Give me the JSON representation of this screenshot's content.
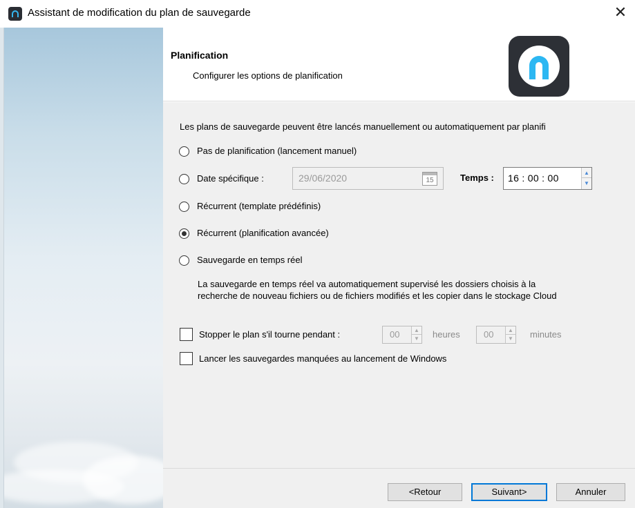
{
  "window": {
    "title": "Assistant de modification du plan de sauvegarde",
    "close_glyph": "✕"
  },
  "header": {
    "title": "Planification",
    "subtitle": "Configurer les options de planification",
    "logo_icon": "app-logo-icon"
  },
  "intro_text": "Les plans de sauvegarde peuvent être lancés manuellement ou automatiquement par planifi",
  "options": {
    "none": {
      "label": "Pas de planification (lancement manuel)",
      "selected": false
    },
    "specific_date": {
      "label": "Date spécifique :",
      "selected": false
    },
    "recurrent_template": {
      "label": "Récurrent (template prédéfinis)",
      "selected": false
    },
    "recurrent_advanced": {
      "label": "Récurrent (planification avancée)",
      "selected": true
    },
    "realtime": {
      "label": "Sauvegarde en temps réel",
      "selected": false
    }
  },
  "date_field": {
    "value": "29/06/2020",
    "calendar_icon_text": "15",
    "enabled": false
  },
  "time_field": {
    "label": "Temps :",
    "value": "16 : 00 : 00"
  },
  "realtime_description": "La sauvegarde en temps réel va automatiquement supervisé les dossiers choisis à la recherche de nouveau fichiers ou de fichiers modifiés et les copier dans le stockage Cloud",
  "stop_plan": {
    "label": "Stopper le plan s'il tourne pendant :",
    "checked": false,
    "hours_value": "00",
    "hours_unit": "heures",
    "minutes_value": "00",
    "minutes_unit": "minutes"
  },
  "missed_backups": {
    "label": "Lancer les sauvegardes manquées au lancement de Windows",
    "checked": false
  },
  "buttons": {
    "back": "<Retour",
    "next": "Suivant>",
    "cancel": "Annuler"
  },
  "colors": {
    "accent": "#0078d7",
    "logo_blue": "#2cb7f2",
    "logo_dark": "#2d3036"
  }
}
